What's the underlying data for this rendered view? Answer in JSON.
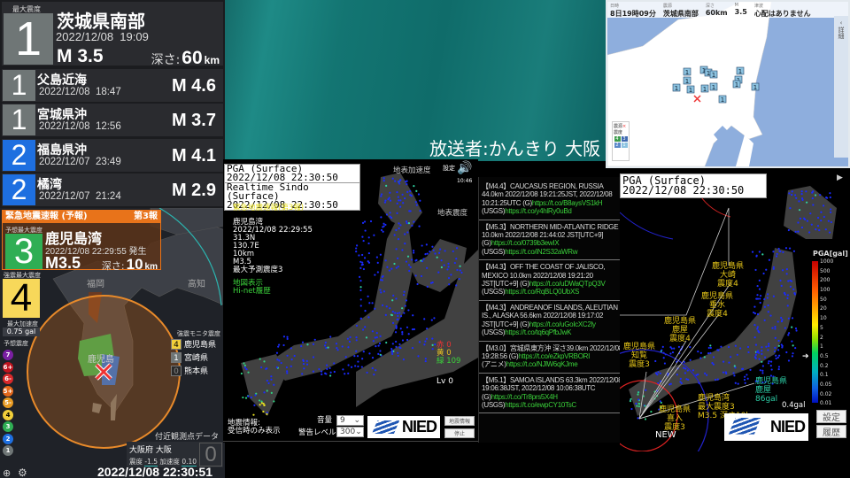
{
  "broadcaster": "放送者:かんきり 大阪",
  "latest": {
    "max_label": "最大震度",
    "shindo": "1",
    "place": "茨城県南部",
    "datetime": "2022/12/08  19:09",
    "mag": "M 3.5",
    "depth_label": "深さ:",
    "depth": "60",
    "depth_unit": "km"
  },
  "history": [
    {
      "shindo": "1",
      "place": "父島近海",
      "datetime": "2022/12/08  18:47",
      "mag": "M 4.6",
      "color": "#6f7676"
    },
    {
      "shindo": "1",
      "place": "宮城県沖",
      "datetime": "2022/12/08  12:56",
      "mag": "M 3.7",
      "color": "#6f7676"
    },
    {
      "shindo": "2",
      "place": "福島県沖",
      "datetime": "2022/12/07  23:49",
      "mag": "M 4.1",
      "color": "#1e6fe0"
    },
    {
      "shindo": "2",
      "place": "橘湾",
      "datetime": "2022/12/07  21:24",
      "mag": "M 2.9",
      "color": "#1e6fe0"
    }
  ],
  "eew": {
    "title": "緊急地震速報 (予報)",
    "report": "第3報",
    "pred_label": "予想最大震度",
    "pred_shindo": "3",
    "place": "鹿児島湾",
    "datetime": "2022/12/08 22:29:55 発生",
    "mag": "M3.5",
    "depth_label": "深さ:",
    "depth": "10",
    "depth_unit": "km",
    "kmon_label": "強震最大震度",
    "kmon_shindo": "4",
    "acc_label": "最大加速度",
    "acc_value": "0.75 gal",
    "legend_label": "予想震度",
    "legend": [
      {
        "t": "7",
        "c": "#7a1fa2"
      },
      {
        "t": "6+",
        "c": "#c0141e"
      },
      {
        "t": "6-",
        "c": "#d8282a"
      },
      {
        "t": "5+",
        "c": "#e3681b"
      },
      {
        "t": "5-",
        "c": "#e79a22"
      },
      {
        "t": "4",
        "c": "#f1cf3a"
      },
      {
        "t": "3",
        "c": "#2fae54"
      },
      {
        "t": "2",
        "c": "#1e6fe0"
      },
      {
        "t": "1",
        "c": "#6f7676"
      }
    ],
    "map_labels": {
      "fukuoka": "福岡",
      "kochi": "高知",
      "kagoshima": "鹿児島"
    },
    "monitor_label": "強震モニタ震度",
    "monitor": [
      {
        "s": "4",
        "name": "鹿児島県",
        "c": "#f1cf3a",
        "fg": "#000"
      },
      {
        "s": "1",
        "name": "宮崎県",
        "c": "#6f7676",
        "fg": "#fff"
      },
      {
        "s": "0",
        "name": "熊本県",
        "c": "#2a2a2a",
        "fg": "#888"
      }
    ],
    "nearby_label": "付近観測点データ",
    "nearby_station": "大阪府 大阪",
    "nearby_shindo_label": "震度",
    "nearby_shindo": "-1.5",
    "nearby_acc_label": "加速度",
    "nearby_acc": "0.10",
    "nearby_big": "0",
    "clock": "2022/12/08 22:30:51"
  },
  "kmoni": {
    "pga_title": "PGA (Surface)",
    "pga_time": "2022/12/08 22:30:50",
    "rs_title": "Realtime Sindo (Surface)",
    "rs_time": "2022/12/08 22:30:50",
    "acc_label": "地表加速度",
    "shindo_label": "地表震度",
    "settings": "設定",
    "time": "10:46",
    "eew_title": "緊急地震速報(第3報)",
    "eew_lines": [
      "鹿児島湾",
      "2022/12/08 22:29:55",
      "31.3N",
      "130.7E",
      "10km",
      "M3.5",
      "最大予測震度3"
    ],
    "links": [
      "地図表示",
      "Hi-net履歴"
    ],
    "red": "赤 0",
    "yellow": "黄 0",
    "green": "緑 109",
    "lv": "Lv 0",
    "info_note": "地震情報:\n受信時のみ表示",
    "volume_label": "音量",
    "volume": "9",
    "warn_label": "警告レベル",
    "warn": "300",
    "nied": "NIED",
    "btn_info": "地震情報",
    "btn_stop": "停止"
  },
  "feed": [
    {
      "head": "【M4.4】CAUCASUS REGION, RUSSIA 44.0km 2022/12/08 19:21:25JST, 2022/12/08 10:21:25UTC",
      "g": "https://t.co/B8aysVS1kH",
      "usgs": "https://t.co/y4hlRy0uBd"
    },
    {
      "head": "【M5.3】NORTHERN MID-ATLANTIC RIDGE 10.0km 2022/12/08 21:44:02 JST[UTC+9]",
      "g": "https://t.co/0739b3ewIX",
      "usgs": "https://t.co/iN2S32aWRw"
    },
    {
      "head": "【M4.3】OFF THE COAST OF JALISCO, MEXICO 10.0km 2022/12/08 19:21:20 JST[UTC+9]",
      "g": "https://t.co/uDWaQTpQ3V",
      "usgs": "https://t.co/RqBLQ0UbXS"
    },
    {
      "head": "【M4.3】ANDREANOF ISLANDS, ALEUTIAN IS., ALASKA 56.6km 2022/12/08 19:17:02 JST[UTC+9]",
      "g": "https://t.co/uGoIcXC2ly",
      "usgs": "https://t.co/tq6qPfbJwK"
    },
    {
      "head": "【M3.0】宮城県東方沖 深さ39.0km 2022/12/08 19:28:56",
      "g": "https://t.co/eZkpVRBORI",
      "usgs": "https://t.co/NJlW6qKJme",
      "usgs_label": "(アニメ)"
    },
    {
      "head": "【M5.1】SAMOA ISLANDS 63.3km 2022/12/08 19:06:38JST, 2022/12/08 10:06:38UTC",
      "g": "https://t.co/Tr8prs5X4H",
      "usgs": "https://t.co/ewpCY10TsC"
    }
  ],
  "pga_map": {
    "title": "PGA (Surface)",
    "time": "2022/12/08 22:30:50",
    "scale_title": "PGA[gal]",
    "scale": [
      "1000",
      "500",
      "200",
      "100",
      "50",
      "20",
      "10",
      "5",
      "2",
      "1",
      "0.5",
      "0.2",
      "0.1",
      "0.05",
      "0.02",
      "0.01"
    ],
    "labels": [
      {
        "t": "鹿児島県\n大崎\n震度4"
      },
      {
        "t": "鹿児島県\n垂水\n震度4"
      },
      {
        "t": "鹿児島県\n鹿屋\n震度4"
      },
      {
        "t": "鹿児島県\n知覧\n震度3"
      },
      {
        "t": "鹿児島県\n喜入\n震度3"
      },
      {
        "t": "鹿児島湾\n最大震度3\nM3.5 深さ10km"
      }
    ],
    "max_label": "鹿児島県\n鹿屋\n86gal",
    "current": "0.4gal",
    "new": "NEW",
    "nied": "NIED",
    "btn_settings": "設定",
    "btn_history": "履歴"
  },
  "jma": {
    "headers": [
      "日時",
      "震源",
      "深さ",
      "M",
      "津波"
    ],
    "values": [
      "8日19時09分",
      "茨城県南部",
      "60km",
      "3.5",
      "心配はありません"
    ],
    "detail": "詳細",
    "epicenter_label": "震源",
    "shindo_label": "震度",
    "legend": [
      "4",
      "3",
      "2",
      "1"
    ],
    "legend2": [
      "7"
    ]
  }
}
